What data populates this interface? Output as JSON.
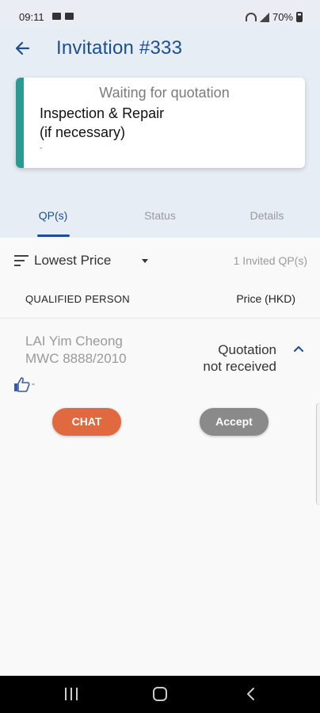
{
  "status_bar": {
    "time": "09:11",
    "battery": "70%"
  },
  "header": {
    "title": "Invitation #333",
    "back_icon": "arrow-left-icon"
  },
  "card": {
    "status": "Waiting for quotation",
    "title_line1": "Inspection & Repair",
    "title_line2": "(if necessary)",
    "subtitle": "-",
    "accent_color": "#2a9a92"
  },
  "tabs": [
    {
      "label": "QP(s)",
      "active": true
    },
    {
      "label": "Status",
      "active": false
    },
    {
      "label": "Details",
      "active": false
    }
  ],
  "sort": {
    "label": "Lowest Price",
    "invited_count": "1 Invited QP(s)"
  },
  "list_header": {
    "qualified_person": "QUALIFIED PERSON",
    "price": "Price (HKD)"
  },
  "qp_items": [
    {
      "name": "LAI Yim Cheong",
      "registration": "MWC 8888/2010",
      "rating": "-",
      "quote_line1": "Quotation",
      "quote_line2": "not received",
      "chat_label": "CHAT",
      "accept_label": "Accept"
    }
  ],
  "colors": {
    "primary": "#1b4f8f",
    "chat_button": "#e1693f",
    "accept_button": "#8a8a8a"
  }
}
